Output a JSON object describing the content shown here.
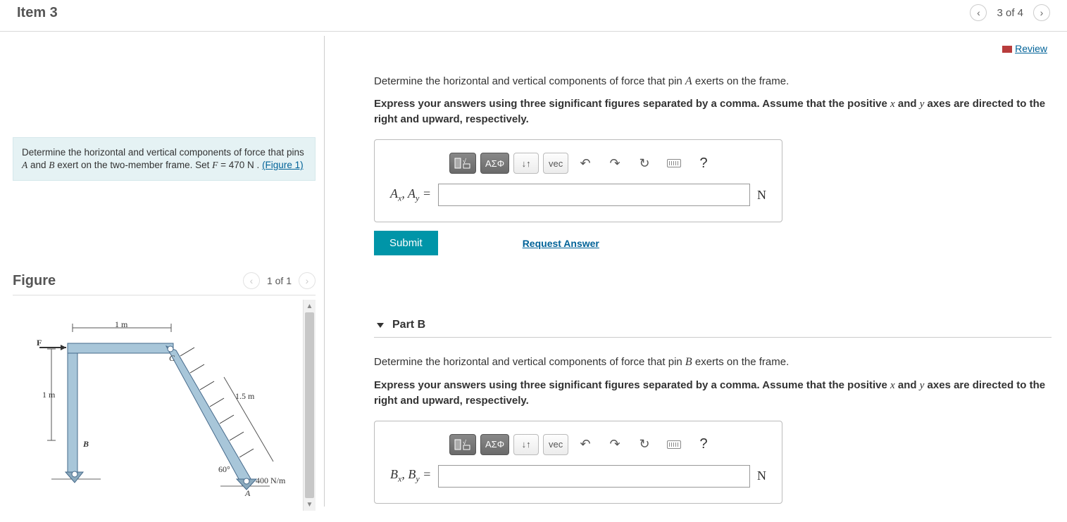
{
  "header": {
    "item_title": "Item 3",
    "counter": "3 of 4"
  },
  "left": {
    "problem_intro": "Determine the horizontal and vertical components of force that pins ",
    "problem_pins": "A",
    "problem_and": " and ",
    "problem_pin_b": "B",
    "problem_rest": " exert on the two-member frame. Set ",
    "problem_fvar": "F",
    "problem_eq": " = 470 ",
    "problem_unit": "N",
    "problem_tail": " . ",
    "figure_link": "(Figure 1)",
    "figure_title": "Figure",
    "figure_counter": "1 of 1",
    "fig_labels": {
      "top_dim": "1 m",
      "left_dim": "1 m",
      "slant_dim": "1.5 m",
      "angle": "60°",
      "load": "400 N/m",
      "F": "F",
      "B": "B",
      "C": "C",
      "A": "A"
    }
  },
  "right": {
    "review": "Review",
    "partA": {
      "question_pre": "Determine the horizontal and vertical components of force that pin ",
      "question_pin": "A",
      "question_post": " exerts on the frame.",
      "instruction_pre": "Express your answers using three significant figures separated by a comma. Assume that the positive ",
      "ivar_x": "x",
      "instruction_mid": " and ",
      "ivar_y": "y",
      "instruction_post": " axes are directed to the right and upward, respectively.",
      "label_html": "A_x, A_y =",
      "unit": "N",
      "submit": "Submit",
      "request": "Request Answer",
      "toolbar": {
        "greek": "ΑΣΦ",
        "vec": "vec",
        "help": "?"
      }
    },
    "partB": {
      "title": "Part B",
      "question_pre": "Determine the horizontal and vertical components of force that pin ",
      "question_pin": "B",
      "question_post": " exerts on the frame.",
      "instruction_pre": "Express your answers using three significant figures separated by a comma. Assume that the positive ",
      "ivar_x": "x",
      "instruction_mid": " and ",
      "ivar_y": "y",
      "instruction_post": " axes are directed to the right and upward, respectively.",
      "label_html": "B_x, B_y =",
      "unit": "N",
      "toolbar": {
        "greek": "ΑΣΦ",
        "vec": "vec",
        "help": "?"
      }
    }
  }
}
